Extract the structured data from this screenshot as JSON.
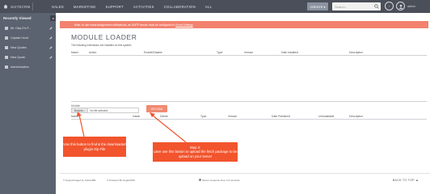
{
  "topnav": {
    "brand": "SUITECRM",
    "menu": [
      "SALES",
      "MARKETING",
      "SUPPORT",
      "ACTIVITIES",
      "COLLABORATION",
      "ALL"
    ],
    "create_label": "CREATE",
    "search_placeholder": "Search...",
    "user_label": "admin"
  },
  "sidebar": {
    "heading": "Recently Viewed",
    "items": [
      {
        "label": "Mr. Clay D's P..."
      },
      {
        "label": "Captain Hood"
      },
      {
        "label": "New Quotes"
      },
      {
        "label": "New Quote"
      },
      {
        "label": "Administration"
      }
    ]
  },
  "notice": {
    "text": "Note: to use email assignment notifications, an SMTP server must be configured in",
    "link": "Email Settings"
  },
  "page": {
    "title": "MODULE LOADER",
    "installed_desc": "The following extensions are installed on this system:",
    "installed_columns": [
      "Name",
      "Action",
      "Enable/Disable",
      "Type",
      "Version",
      "Date Installed",
      "Description"
    ],
    "package_label": "Module",
    "browse_label": "Browse...",
    "no_file_label": "No file selected.",
    "upload_label": "UPLOAD",
    "uploaded_columns": [
      "Name",
      "Install",
      "Delete",
      "Type",
      "Version",
      "Date Published",
      "Uninstallable",
      "Description"
    ]
  },
  "callouts": {
    "step1": "Use this button to find & the downloaded plugin Zip File",
    "step2_title": "Step 2:",
    "step2_body": "Later use this button to upload the fetch package to be upload on your server"
  },
  "footer": {
    "supercharged": "© Supercharged by SuiteCRM",
    "powered": "© Powered By SugarCRM",
    "response": "Server response time: 0.3 seconds.",
    "back_to_top": "BACK TO TOP"
  },
  "colors": {
    "nav": "#4a4f5a",
    "sidebar": "#5c6370",
    "notice": "#f2826e",
    "callout": "#f2542d",
    "upload": "#f08a72"
  }
}
